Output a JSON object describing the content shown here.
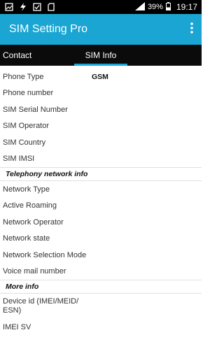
{
  "status_bar": {
    "battery": "39%",
    "time": "19:17"
  },
  "app_bar": {
    "title": "SIM Setting Pro"
  },
  "tabs": [
    {
      "label": "Contact"
    },
    {
      "label": "SIM Info"
    }
  ],
  "sim_info": {
    "rows": [
      {
        "label": "Phone Type",
        "value": "GSM"
      },
      {
        "label": "Phone number",
        "value": ""
      },
      {
        "label": "SIM Serial Number",
        "value": ""
      },
      {
        "label": "SIM Operator",
        "value": ""
      },
      {
        "label": "SIM Country",
        "value": ""
      },
      {
        "label": "SIM IMSI",
        "value": ""
      }
    ]
  },
  "telephony": {
    "header": "Telephony network info",
    "rows": [
      {
        "label": "Network Type"
      },
      {
        "label": "Active Roaming"
      },
      {
        "label": "Network Operator"
      },
      {
        "label": "Network state"
      },
      {
        "label": "Network Selection Mode"
      },
      {
        "label": "Voice mail number"
      }
    ]
  },
  "more_info": {
    "header": "More info",
    "rows": [
      {
        "label": "Device id (IMEI/MEID/ ESN)"
      },
      {
        "label": "IMEI SV"
      }
    ]
  }
}
